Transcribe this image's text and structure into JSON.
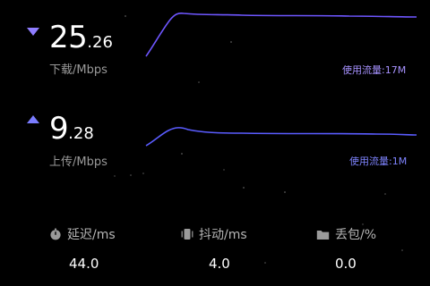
{
  "download": {
    "value_int": "25",
    "value_dec": ".26",
    "unit_label": "下载/Mbps",
    "usage_label": "使用流量:17M",
    "color": "#8c7bff",
    "usage_color": "#a792ff"
  },
  "upload": {
    "value_int": "9",
    "value_dec": ".28",
    "unit_label": "上传/Mbps",
    "usage_label": "使用流量:1M",
    "color": "#6f72ff",
    "usage_color": "#7f84ff"
  },
  "stats": [
    {
      "icon": "stopwatch-icon",
      "label": "延迟/ms",
      "value": "44.0"
    },
    {
      "icon": "vibration-icon",
      "label": "抖动/ms",
      "value": "4.0"
    },
    {
      "icon": "folder-icon",
      "label": "丢包/%",
      "value": "0.0"
    }
  ]
}
